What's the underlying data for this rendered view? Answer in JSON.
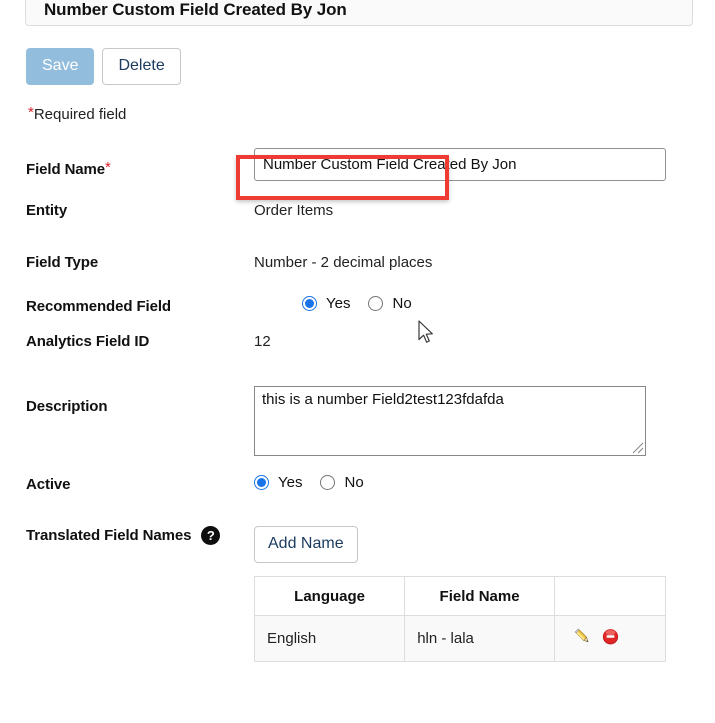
{
  "panel": {
    "title": "Number Custom Field Created By Jon"
  },
  "toolbar": {
    "save_label": "Save",
    "delete_label": "Delete"
  },
  "required_note": {
    "star": "*",
    "text": "Required field"
  },
  "form": {
    "field_name": {
      "label": "Field Name",
      "required_marker": "*",
      "value": "Number Custom Field Created By Jon",
      "placeholder": ""
    },
    "entity": {
      "label": "Entity",
      "value": "Order Items"
    },
    "field_type": {
      "label": "Field Type",
      "value": "Number - 2 decimal places"
    },
    "recommended_field": {
      "label": "Recommended Field",
      "yes_label": "Yes",
      "no_label": "No",
      "selected": "Yes",
      "highlight_color": "#ee3b33"
    },
    "analytics_field_id": {
      "label": "Analytics Field ID",
      "value": "12"
    },
    "description": {
      "label": "Description",
      "value": "this is a number Field2test123fdafda",
      "placeholder": ""
    },
    "active": {
      "label": "Active",
      "yes_label": "Yes",
      "no_label": "No",
      "selected": "Yes"
    },
    "translated_field_names": {
      "label": "Translated Field Names",
      "help_glyph": "?",
      "add_button_label": "Add Name",
      "table": {
        "columns": [
          "Language",
          "Field Name",
          ""
        ],
        "rows": [
          {
            "language": "English",
            "field_name": "hln - lala",
            "edit_action": "edit",
            "delete_action": "delete"
          }
        ]
      }
    }
  },
  "colors": {
    "save_button": "#93bddc",
    "radio_selected": "#1a73e8",
    "required_star": "#d9232d",
    "highlight": "#ee3b33",
    "link_text": "#1b3b5f"
  }
}
